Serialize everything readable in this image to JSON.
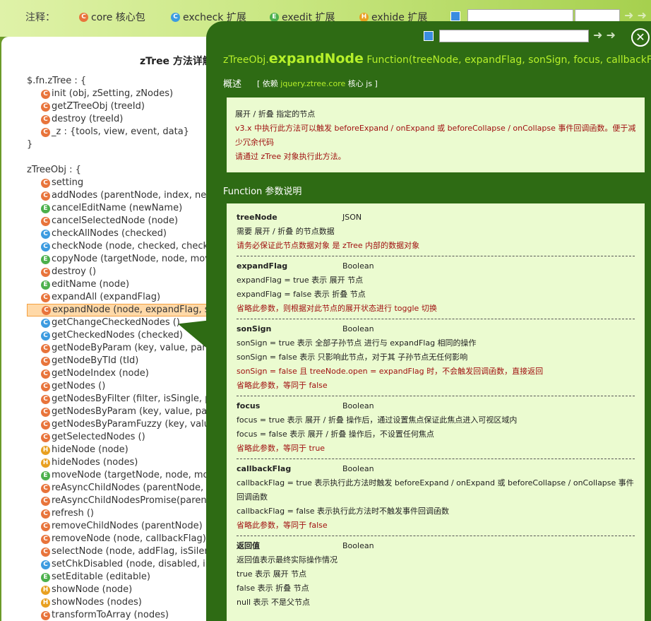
{
  "topbar": {
    "legend_label": "注释：",
    "legends": [
      {
        "icon": "C",
        "text": "core 核心包",
        "color": "#e8743b"
      },
      {
        "icon": "C",
        "text": "excheck 扩展",
        "color": "#3c9be0"
      },
      {
        "icon": "E",
        "text": "exedit 扩展",
        "color": "#4cb04c"
      },
      {
        "icon": "H",
        "text": "exhide 扩展",
        "color": "#e8a020"
      }
    ],
    "arrows": "➜ ➜"
  },
  "left": {
    "title": "zTree 方法详解",
    "lines": [
      {
        "text": "$.fn.zTree : {",
        "indent": false
      },
      {
        "text": "init (obj, zSetting, zNodes)",
        "indent": true,
        "icon": "C"
      },
      {
        "text": "getZTreeObj (treeId)",
        "indent": true,
        "icon": "C"
      },
      {
        "text": "destroy (treeId)",
        "indent": true,
        "icon": "C"
      },
      {
        "text": "_z : {tools, view, event, data}",
        "indent": true,
        "icon": "C"
      },
      {
        "text": "}",
        "indent": false
      },
      {
        "text": "",
        "indent": false
      },
      {
        "text": "zTreeObj : {",
        "indent": false
      },
      {
        "text": "setting",
        "indent": true,
        "icon": "C"
      },
      {
        "text": "addNodes (parentNode, index, newNodes",
        "indent": true,
        "icon": "C"
      },
      {
        "text": "cancelEditName (newName)",
        "indent": true,
        "icon": "E"
      },
      {
        "text": "cancelSelectedNode (node)",
        "indent": true,
        "icon": "C"
      },
      {
        "text": "checkAllNodes (checked)",
        "indent": true,
        "icon": "X"
      },
      {
        "text": "checkNode (node, checked, checkTypeFl",
        "indent": true,
        "icon": "X"
      },
      {
        "text": "copyNode (targetNode, node, moveTyp",
        "indent": true,
        "icon": "E"
      },
      {
        "text": "destroy ()",
        "indent": true,
        "icon": "C"
      },
      {
        "text": "editName (node)",
        "indent": true,
        "icon": "E"
      },
      {
        "text": "expandAll (expandFlag)",
        "indent": true,
        "icon": "C"
      },
      {
        "text": "expandNode (node, expandFlag, son",
        "indent": true,
        "icon": "C",
        "highlight": true
      },
      {
        "text": "getChangeCheckedNodes ()",
        "indent": true,
        "icon": "X"
      },
      {
        "text": "getCheckedNodes (checked)",
        "indent": true,
        "icon": "X"
      },
      {
        "text": "getNodeByParam (key, value, parent",
        "indent": true,
        "icon": "C"
      },
      {
        "text": "getNodeByTId (tId)",
        "indent": true,
        "icon": "C"
      },
      {
        "text": "getNodeIndex (node)",
        "indent": true,
        "icon": "C"
      },
      {
        "text": "getNodes ()",
        "indent": true,
        "icon": "C"
      },
      {
        "text": "getNodesByFilter (filter, isSingle, pare",
        "indent": true,
        "icon": "C"
      },
      {
        "text": "getNodesByParam (key, value, parentNo",
        "indent": true,
        "icon": "C"
      },
      {
        "text": "getNodesByParamFuzzy (key, value, par",
        "indent": true,
        "icon": "C"
      },
      {
        "text": "getSelectedNodes ()",
        "indent": true,
        "icon": "C"
      },
      {
        "text": "hideNode (node)",
        "indent": true,
        "icon": "H"
      },
      {
        "text": "hideNodes (nodes)",
        "indent": true,
        "icon": "H"
      },
      {
        "text": "moveNode (targetNode, node, moveTyp",
        "indent": true,
        "icon": "E"
      },
      {
        "text": "reAsyncChildNodes (parentNode, reloadT",
        "indent": true,
        "icon": "C"
      },
      {
        "text": "reAsyncChildNodesPromise(parentNode",
        "indent": true,
        "icon": "C"
      },
      {
        "text": "refresh ()",
        "indent": true,
        "icon": "C"
      },
      {
        "text": "removeChildNodes (parentNode)",
        "indent": true,
        "icon": "C"
      },
      {
        "text": "removeNode (node, callbackFlag)",
        "indent": true,
        "icon": "C"
      },
      {
        "text": "selectNode (node, addFlag, isSilent)",
        "indent": true,
        "icon": "C"
      },
      {
        "text": "setChkDisabled (node, disabled, inherit",
        "indent": true,
        "icon": "X"
      },
      {
        "text": "setEditable (editable)",
        "indent": true,
        "icon": "E"
      },
      {
        "text": "showNode (node)",
        "indent": true,
        "icon": "H"
      },
      {
        "text": "showNodes (nodes)",
        "indent": true,
        "icon": "H"
      },
      {
        "text": "transformToArray (nodes)",
        "indent": true,
        "icon": "C"
      }
    ]
  },
  "overlay": {
    "signature_prefix": "zTreeObj.",
    "signature_name": "expandNode",
    "signature_suffix": " Function(treeNode, expandFlag, sonSign, focus, callbackFlag)",
    "overview_label": "概述",
    "dep_prefix": "[ 依赖 ",
    "dep_file": "jquery.ztree.core",
    "dep_suffix": " 核心 js ]",
    "description": [
      {
        "text": "展开 / 折叠 指定的节点",
        "red": false
      },
      {
        "text": "v3.x 中执行此方法可以触发 beforeExpand / onExpand 或 beforeCollapse / onCollapse 事件回调函数。便于减少冗余代码",
        "red": true
      },
      {
        "text": "请通过 zTree 对象执行此方法。",
        "red": true
      }
    ],
    "params_title": "Function 参数说明",
    "params": [
      {
        "name": "treeNode",
        "type": "JSON",
        "lines": [
          {
            "text": "需要 展开 / 折叠 的节点数据",
            "red": false
          },
          {
            "text": "请务必保证此节点数据对象 是 zTree 内部的数据对象",
            "red": true
          }
        ]
      },
      {
        "name": "expandFlag",
        "type": "Boolean",
        "lines": [
          {
            "text": "expandFlag = true 表示 展开 节点",
            "red": false
          },
          {
            "text": "expandFlag = false 表示 折叠 节点",
            "red": false
          },
          {
            "text": "省略此参数，则根据对此节点的展开状态进行 toggle 切换",
            "red": true
          }
        ]
      },
      {
        "name": "sonSign",
        "type": "Boolean",
        "lines": [
          {
            "text": "sonSign = true 表示 全部子孙节点 进行与 expandFlag 相同的操作",
            "red": false
          },
          {
            "text": "sonSign = false 表示 只影响此节点，对于其 子孙节点无任何影响",
            "red": false
          },
          {
            "text": "sonSign = false 且 treeNode.open = expandFlag 时，不会触发回调函数，直接返回",
            "red": true
          },
          {
            "text": "省略此参数，等同于 false",
            "red": true
          }
        ]
      },
      {
        "name": "focus",
        "type": "Boolean",
        "lines": [
          {
            "text": "focus = true 表示 展开 / 折叠 操作后，通过设置焦点保证此焦点进入可视区域内",
            "red": false
          },
          {
            "text": "focus = false 表示 展开 / 折叠 操作后，不设置任何焦点",
            "red": false
          },
          {
            "text": "省略此参数，等同于 true",
            "red": true
          }
        ]
      },
      {
        "name": "callbackFlag",
        "type": "Boolean",
        "lines": [
          {
            "text": "callbackFlag = true 表示执行此方法时触发 beforeExpand / onExpand 或 beforeCollapse / onCollapse 事件回调函数",
            "red": false
          },
          {
            "text": "callbackFlag = false 表示执行此方法时不触发事件回调函数",
            "red": false
          },
          {
            "text": "省略此参数，等同于 false",
            "red": true
          }
        ]
      },
      {
        "name": "返回值",
        "type": "Boolean",
        "lines": [
          {
            "text": "返回值表示最终实际操作情况",
            "red": false
          },
          {
            "text": "true 表示 展开 节点",
            "red": false
          },
          {
            "text": "false 表示 折叠 节点",
            "red": false
          },
          {
            "text": "null 表示 不是父节点",
            "red": false
          }
        ]
      }
    ]
  }
}
